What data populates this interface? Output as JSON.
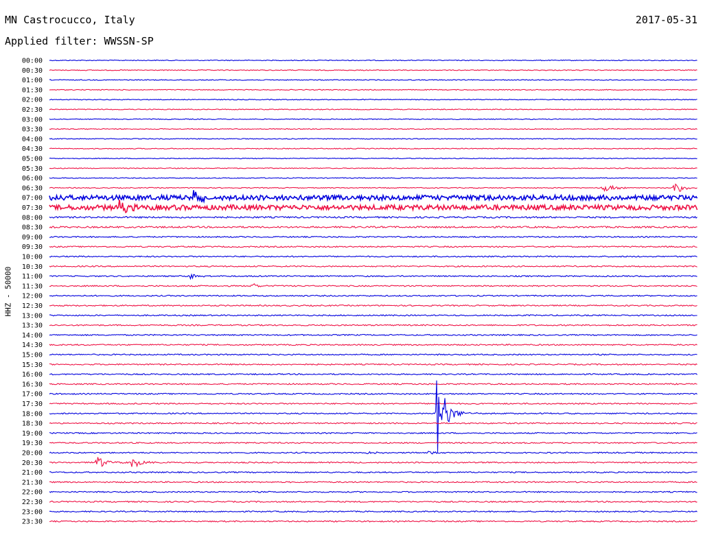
{
  "header": {
    "station": "MN Castrocucco, Italy",
    "filter": "Applied filter: WWSSN-SP",
    "date": "2017-05-31"
  },
  "colors": {
    "even_trace": "#0000dd",
    "odd_trace": "#ee1144"
  },
  "chart_data": {
    "type": "line",
    "ylabel": "HHZ - 50000",
    "rows": [
      "00:00",
      "00:30",
      "01:00",
      "01:30",
      "02:00",
      "02:30",
      "03:00",
      "03:30",
      "04:00",
      "04:30",
      "05:00",
      "05:30",
      "06:00",
      "06:30",
      "07:00",
      "07:30",
      "08:00",
      "08:30",
      "09:00",
      "09:30",
      "10:00",
      "10:30",
      "11:00",
      "11:30",
      "12:00",
      "12:30",
      "13:00",
      "13:30",
      "14:00",
      "14:30",
      "15:00",
      "15:30",
      "16:00",
      "16:30",
      "17:00",
      "17:30",
      "18:00",
      "18:30",
      "19:00",
      "19:30",
      "20:00",
      "20:30",
      "21:00",
      "21:30",
      "22:00",
      "22:30",
      "23:00",
      "23:30"
    ],
    "x_unit": "minutes within row",
    "x_range": [
      0,
      30
    ],
    "noise_level": [
      1,
      1,
      1,
      1,
      1,
      1,
      1,
      1,
      1,
      1,
      1,
      1,
      1,
      1,
      6,
      6,
      2,
      2,
      1.5,
      1.5,
      1.5,
      1.5,
      1.5,
      1.5,
      1.5,
      1.5,
      1.5,
      1.5,
      1.5,
      1.5,
      1.5,
      1.5,
      1.5,
      1.5,
      1.5,
      1.5,
      1.5,
      1.5,
      1.5,
      1.5,
      1.5,
      1.5,
      1.5,
      1.5,
      1.5,
      1.5,
      1.5,
      1.5
    ],
    "events": [
      {
        "row": "06:30",
        "minute": 25.6,
        "peak": 9
      },
      {
        "row": "06:30",
        "minute": 28.9,
        "peak": 11
      },
      {
        "row": "07:00",
        "minute": 0.6,
        "peak": 10
      },
      {
        "row": "07:00",
        "minute": 6.6,
        "peak": 14
      },
      {
        "row": "07:30",
        "minute": 3.2,
        "peak": 12
      },
      {
        "row": "11:00",
        "minute": 6.5,
        "peak": 5
      },
      {
        "row": "11:30",
        "minute": 9.4,
        "peak": 4
      },
      {
        "row": "18:00",
        "minute": 17.9,
        "peak": 68
      },
      {
        "row": "20:30",
        "minute": 2.2,
        "peak": 10
      },
      {
        "row": "20:30",
        "minute": 3.8,
        "peak": 10
      },
      {
        "row": "20:00",
        "minute": 14.7,
        "peak": 4
      },
      {
        "row": "20:00",
        "minute": 17.5,
        "peak": 3
      }
    ]
  }
}
